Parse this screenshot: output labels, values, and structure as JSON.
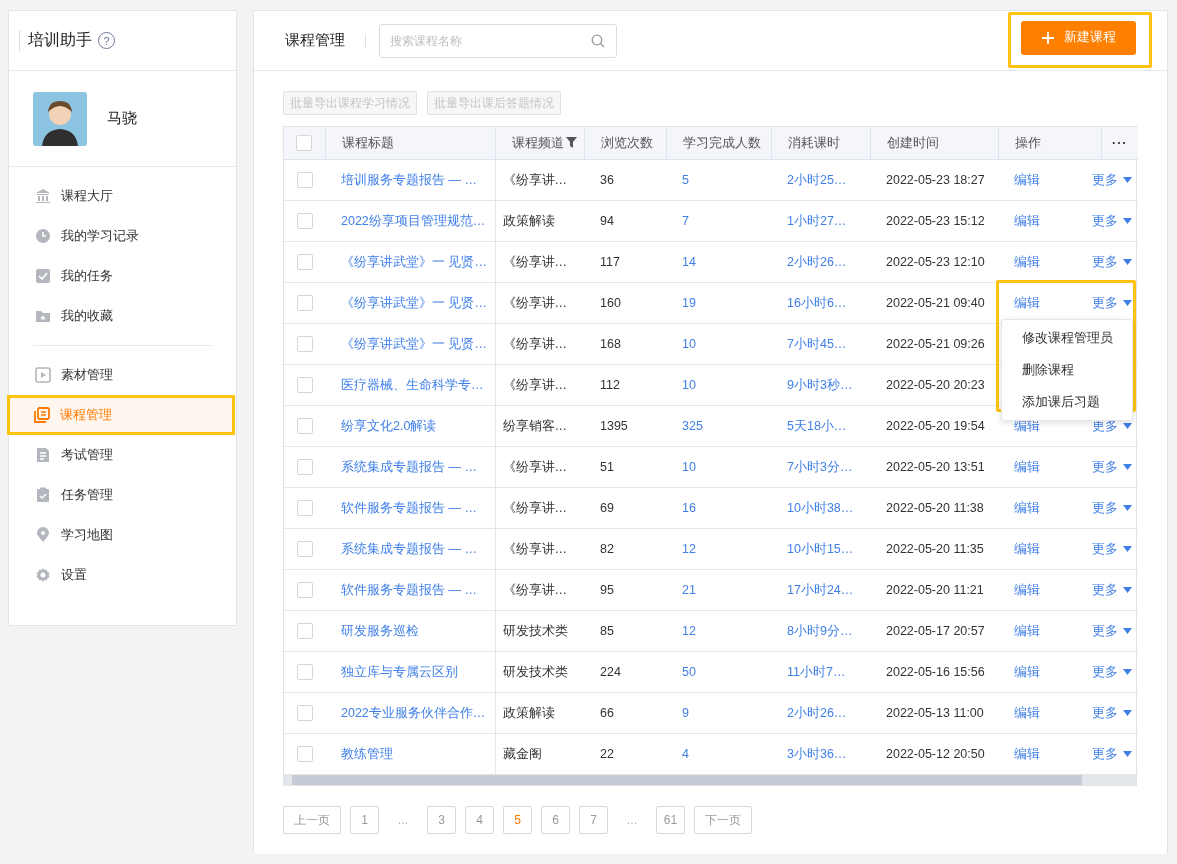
{
  "sidebar": {
    "title": "培训助手",
    "help_icon": "?",
    "user": {
      "name": "马骁"
    },
    "groups": [
      [
        {
          "label": "课程大厅",
          "selected": false
        },
        {
          "label": "我的学习记录",
          "selected": false
        },
        {
          "label": "我的任务",
          "selected": false
        },
        {
          "label": "我的收藏",
          "selected": false
        }
      ],
      [
        {
          "label": "素材管理",
          "selected": false
        },
        {
          "label": "课程管理",
          "selected": true,
          "highlight": true
        },
        {
          "label": "考试管理",
          "selected": false
        },
        {
          "label": "任务管理",
          "selected": false
        },
        {
          "label": "学习地图",
          "selected": false
        },
        {
          "label": "设置",
          "selected": false
        }
      ]
    ]
  },
  "header": {
    "title": "课程管理",
    "search": {
      "placeholder": "搜索课程名称"
    },
    "new_button": {
      "label": "新建课程",
      "highlight": true
    }
  },
  "export_buttons": [
    {
      "label": "批量导出课程学习情况",
      "disabled": true
    },
    {
      "label": "批量导出课后答题情况",
      "disabled": true
    }
  ],
  "table": {
    "select_all": {
      "checked": false
    },
    "columns": [
      "课程标题",
      "课程频道",
      "浏览次数",
      "学习完成人数",
      "消耗课时",
      "创建时间",
      "操作",
      "···"
    ],
    "rows": [
      {
        "checked": false,
        "title": "培训服务专题报告 — …",
        "channel": "《纷享讲…",
        "views": "36",
        "completed": "5",
        "duration": "2小时25…",
        "created": "2022-05-23 18:27",
        "edit": "编辑",
        "more": "更多"
      },
      {
        "checked": false,
        "title": "2022纷享项目管理规范…",
        "channel": "政策解读",
        "views": "94",
        "completed": "7",
        "duration": "1小时27…",
        "created": "2022-05-23 15:12",
        "edit": "编辑",
        "more": "更多"
      },
      {
        "checked": false,
        "title": "《纷享讲武堂》一 见贤…",
        "channel": "《纷享讲…",
        "views": "117",
        "completed": "14",
        "duration": "2小时26…",
        "created": "2022-05-23 12:10",
        "edit": "编辑",
        "more": "更多"
      },
      {
        "checked": false,
        "title": "《纷享讲武堂》一 见贤…",
        "channel": "《纷享讲…",
        "views": "160",
        "completed": "19",
        "duration": "16小时6…",
        "created": "2022-05-21 09:40",
        "edit": "编辑",
        "more": "更多",
        "menu": {
          "highlight": true,
          "items": [
            "修改课程管理员",
            "删除课程",
            "添加课后习题"
          ]
        }
      },
      {
        "checked": false,
        "title": "《纷享讲武堂》一 见贤…",
        "channel": "《纷享讲…",
        "views": "168",
        "completed": "10",
        "duration": "7小时45…",
        "created": "2022-05-21 09:26"
      },
      {
        "checked": false,
        "title": "医疗器械、生命科学专…",
        "channel": "《纷享讲…",
        "views": "112",
        "completed": "10",
        "duration": "9小时3秒…",
        "created": "2022-05-20 20:23"
      },
      {
        "checked": false,
        "title": "纷享文化2.0解读",
        "channel": "纷享销客…",
        "views": "1395",
        "completed": "325",
        "duration": "5天18小…",
        "created": "2022-05-20 19:54",
        "edit": "编辑",
        "more": "更多"
      },
      {
        "checked": false,
        "title": "系统集成专题报告 — …",
        "channel": "《纷享讲…",
        "views": "51",
        "completed": "10",
        "duration": "7小时3分…",
        "created": "2022-05-20 13:51",
        "edit": "编辑",
        "more": "更多"
      },
      {
        "checked": false,
        "title": "软件服务专题报告 — …",
        "channel": "《纷享讲…",
        "views": "69",
        "completed": "16",
        "duration": "10小时38…",
        "created": "2022-05-20 11:38",
        "edit": "编辑",
        "more": "更多"
      },
      {
        "checked": false,
        "title": "系统集成专题报告 — …",
        "channel": "《纷享讲…",
        "views": "82",
        "completed": "12",
        "duration": "10小时15…",
        "created": "2022-05-20 11:35",
        "edit": "编辑",
        "more": "更多"
      },
      {
        "checked": false,
        "title": "软件服务专题报告 — …",
        "channel": "《纷享讲…",
        "views": "95",
        "completed": "21",
        "duration": "17小时24…",
        "created": "2022-05-20 11:21",
        "edit": "编辑",
        "more": "更多"
      },
      {
        "checked": false,
        "title": "研发服务巡检",
        "channel": "研发技术类",
        "views": "85",
        "completed": "12",
        "duration": "8小时9分…",
        "created": "2022-05-17 20:57",
        "edit": "编辑",
        "more": "更多"
      },
      {
        "checked": false,
        "title": "独立库与专属云区别",
        "channel": "研发技术类",
        "views": "224",
        "completed": "50",
        "duration": "11小时7…",
        "created": "2022-05-16 15:56",
        "edit": "编辑",
        "more": "更多"
      },
      {
        "checked": false,
        "title": "2022专业服务伙伴合作…",
        "channel": "政策解读",
        "views": "66",
        "completed": "9",
        "duration": "2小时26…",
        "created": "2022-05-13 11:00",
        "edit": "编辑",
        "more": "更多"
      },
      {
        "checked": false,
        "title": "教练管理",
        "channel": "藏金阁",
        "views": "22",
        "completed": "4",
        "duration": "3小时36…",
        "created": "2022-05-12 20:50",
        "edit": "编辑",
        "more": "更多"
      }
    ]
  },
  "pagination": {
    "prev": "上一页",
    "next": "下一页",
    "pages": [
      {
        "label": "1",
        "selected": false
      },
      {
        "label": "…",
        "kind": "ellipsis"
      },
      {
        "label": "3",
        "selected": false
      },
      {
        "label": "4",
        "selected": false
      },
      {
        "label": "5",
        "selected": true
      },
      {
        "label": "6",
        "selected": false
      },
      {
        "label": "7",
        "selected": false
      },
      {
        "label": "…",
        "kind": "ellipsis"
      },
      {
        "label": "61",
        "selected": false
      }
    ]
  }
}
